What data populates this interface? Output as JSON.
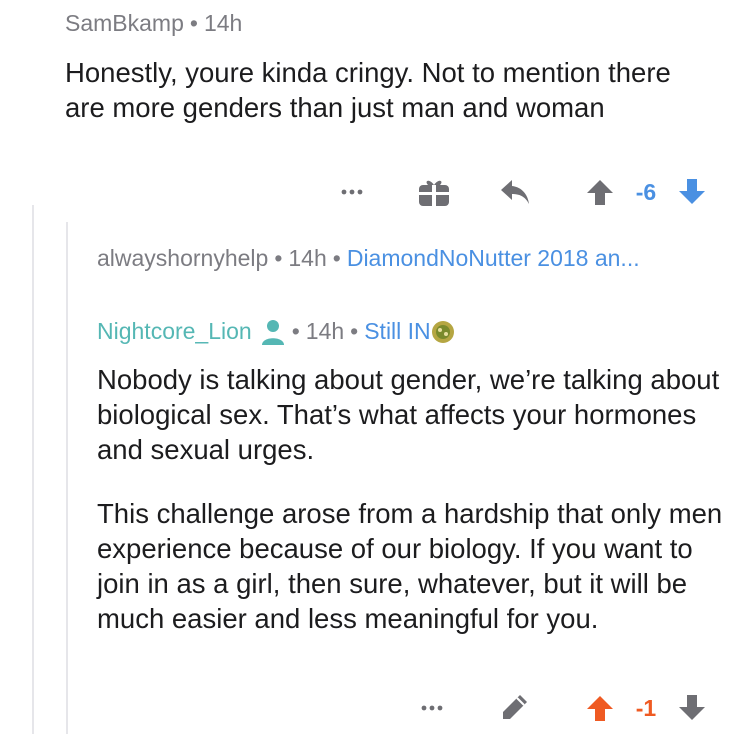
{
  "comment1": {
    "author": "SamBkamp",
    "time": "14h",
    "body": "Honestly, youre kinda cringy. Not to mention there are more genders than just man and woman",
    "score": "-6",
    "vote_color": "#4a90e2"
  },
  "collapsed": {
    "author": "alwayshornyhelp",
    "time": "14h",
    "flair": "DiamondNoNutter 2018 an..."
  },
  "comment2": {
    "author": "Nightcore_Lion",
    "time": "14h",
    "flair": "Still IN",
    "paragraph1": "Nobody is talking about gender, we’re talking about biological sex. That’s what affects your hormones and sexual urges.",
    "paragraph2": "This challenge arose from a hardship that only men experience because of our biology. If you want to join in as a girl, then sure, whatever, but it will be much easier and less meaningful for you.",
    "score": "-1",
    "score_color": "#ef5a22"
  },
  "icons": [
    "more-icon",
    "gift-icon",
    "reply-icon",
    "upvote-icon",
    "downvote-icon",
    "user-icon",
    "flair-badge-icon",
    "edit-icon"
  ],
  "colors": {
    "meta_text": "#7c7c82",
    "body_text": "#1c1c1e",
    "link_blue": "#4a90e2",
    "username_teal": "#55b7b4",
    "upvote_orange": "#ef5a22",
    "icon_gray": "#6e6e73"
  }
}
